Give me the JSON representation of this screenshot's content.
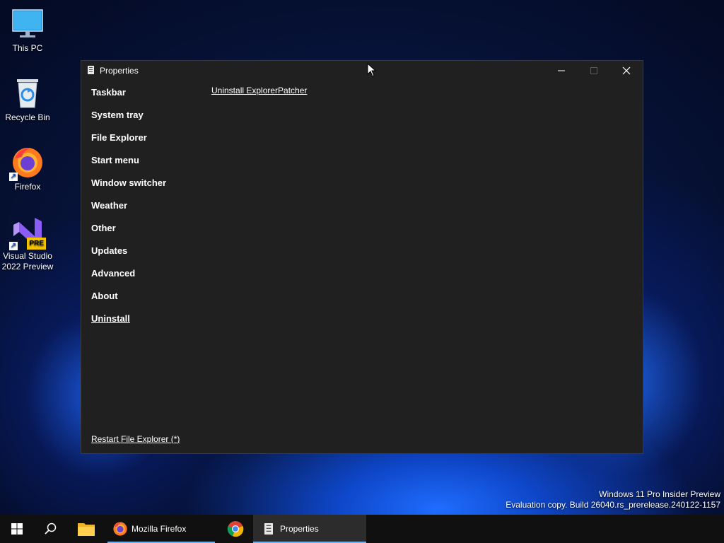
{
  "desktop": {
    "icons": [
      {
        "label": "This PC",
        "icon": "monitor-icon"
      },
      {
        "label": "Recycle Bin",
        "icon": "recycle-bin-icon"
      },
      {
        "label": "Firefox",
        "icon": "firefox-icon"
      },
      {
        "label_line1": "Visual Studio",
        "label_line2": "2022 Preview",
        "badge": "PRE",
        "icon": "visual-studio-icon"
      }
    ]
  },
  "window": {
    "title": "Properties",
    "nav": [
      {
        "label": "Taskbar"
      },
      {
        "label": "System tray"
      },
      {
        "label": "File Explorer"
      },
      {
        "label": "Start menu"
      },
      {
        "label": "Window switcher"
      },
      {
        "label": "Weather"
      },
      {
        "label": "Other"
      },
      {
        "label": "Updates"
      },
      {
        "label": "Advanced"
      },
      {
        "label": "About"
      },
      {
        "label": "Uninstall",
        "active": true
      }
    ],
    "content_link": "Uninstall ExplorerPatcher",
    "restart_link": "Restart File Explorer (*)"
  },
  "watermark": {
    "line1": "Windows 11 Pro Insider Preview",
    "line2": "Evaluation copy. Build 26040.rs_prerelease.240122-1157"
  },
  "taskbar": {
    "items": [
      {
        "label": "Mozilla Firefox",
        "icon": "firefox-icon"
      },
      {
        "label": "Properties",
        "icon": "properties-icon",
        "active": true
      }
    ]
  },
  "colors": {
    "window_bg": "#202020",
    "taskbar_bg": "#101010",
    "accent": "#6fb1ea"
  }
}
